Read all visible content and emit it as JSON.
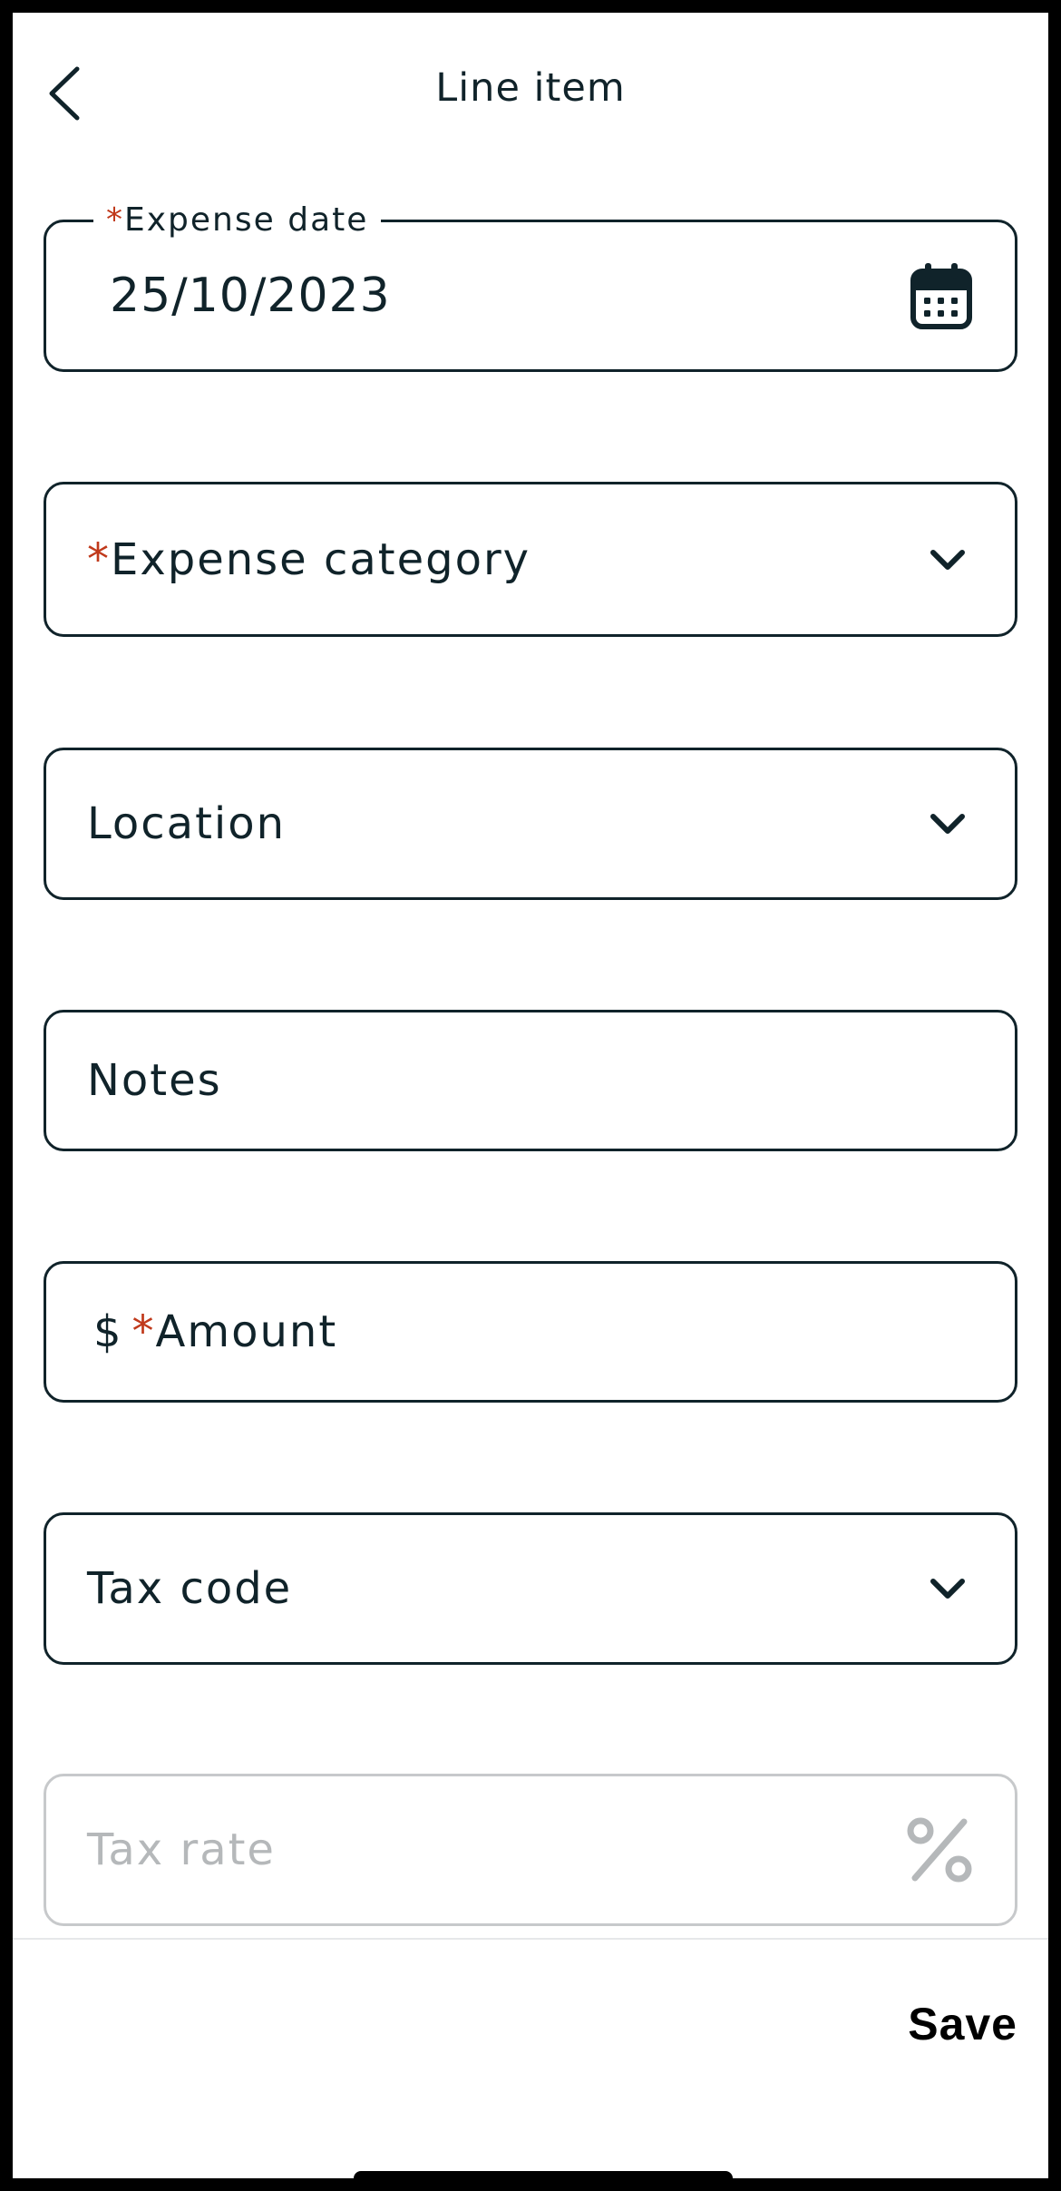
{
  "header": {
    "title": "Line item",
    "back_icon": "chevron-left-icon"
  },
  "form": {
    "expense_date": {
      "required_mark": "*",
      "label": "Expense date",
      "value": "25/10/2023",
      "icon": "calendar-icon"
    },
    "expense_category": {
      "required_mark": "*",
      "placeholder": "Expense category",
      "icon": "chevron-down-icon"
    },
    "location": {
      "placeholder": "Location",
      "icon": "chevron-down-icon"
    },
    "notes": {
      "placeholder": "Notes"
    },
    "amount": {
      "currency": "$",
      "required_mark": "*",
      "placeholder": "Amount"
    },
    "tax_code": {
      "placeholder": "Tax code",
      "icon": "chevron-down-icon"
    },
    "tax_rate": {
      "placeholder": "Tax rate",
      "icon": "percent-icon",
      "disabled": true
    }
  },
  "footer": {
    "save_label": "Save"
  },
  "colors": {
    "text": "#10232a",
    "required": "#c0391b",
    "disabled": "#b5b8ba",
    "border": "#10232a"
  }
}
